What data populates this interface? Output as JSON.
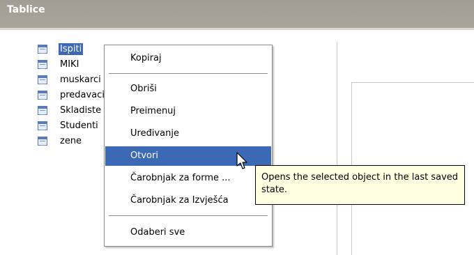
{
  "panel": {
    "title": "Tablice"
  },
  "tree": {
    "items": [
      {
        "label": "Ispiti",
        "selected": true
      },
      {
        "label": "MIKI",
        "selected": false
      },
      {
        "label": "muskarci",
        "selected": false
      },
      {
        "label": "predavaci",
        "selected": false
      },
      {
        "label": "Skladiste",
        "selected": false
      },
      {
        "label": "Studenti",
        "selected": false
      },
      {
        "label": "zene",
        "selected": false
      }
    ]
  },
  "context_menu": {
    "items": [
      {
        "label": "Kopiraj",
        "group": 0
      },
      {
        "label": "Obriši",
        "group": 1
      },
      {
        "label": "Preimenuj",
        "group": 1
      },
      {
        "label": "Uređivanje",
        "group": 1
      },
      {
        "label": "Otvori",
        "group": 1,
        "highlighted": true
      },
      {
        "label": "Čarobnjak za forme ...",
        "group": 1
      },
      {
        "label": "Čarobnjak za Izvješća",
        "group": 1
      },
      {
        "label": "Odaberi sve",
        "group": 2
      }
    ]
  },
  "tooltip": {
    "text": "Opens the selected object in the last saved state."
  },
  "colors": {
    "header_bg": "#a6a299",
    "selection": "#3c69b4",
    "tooltip_bg": "#ffffe1"
  }
}
